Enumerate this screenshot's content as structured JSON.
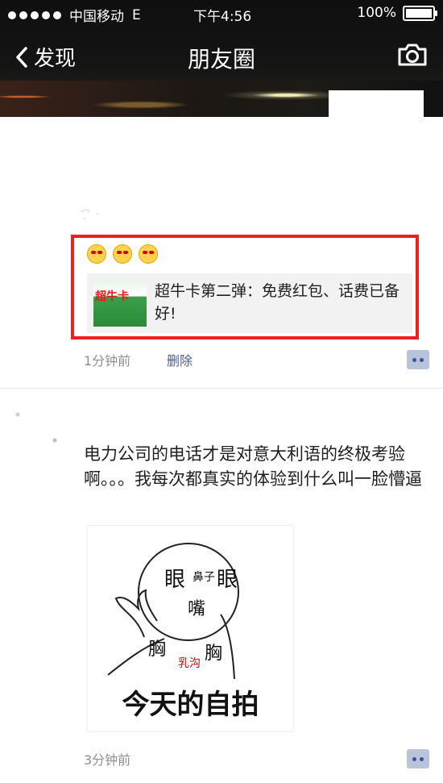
{
  "status_bar": {
    "carrier": "中国移动",
    "network": "E",
    "time": "下午4:56",
    "battery": "100%"
  },
  "nav": {
    "back_label": "发现",
    "title": "朋友圈"
  },
  "posts": [
    {
      "emojis": [
        "laugh-cry-emoji",
        "laugh-cry-emoji",
        "laugh-cry-emoji"
      ],
      "share_title": "超牛卡第二弹：免费红包、话费已备好!",
      "thumb_text": "超牛卡",
      "time": "1分钟前",
      "delete_label": "删除"
    },
    {
      "text": "电力公司的电话才是对意大利语的终极考验啊。。。我每次都真实的体验到什么叫一脸懵逼",
      "meme": {
        "words": [
          "眼",
          "眼",
          "鼻子",
          "嘴",
          "胸",
          "胸",
          "乳沟"
        ],
        "caption": "今天的自拍"
      },
      "time": "3分钟前"
    }
  ],
  "colors": {
    "highlight_border": "#ef1f1f",
    "link_blue": "#4b5e95",
    "meta_gray": "#8f8f8f"
  }
}
